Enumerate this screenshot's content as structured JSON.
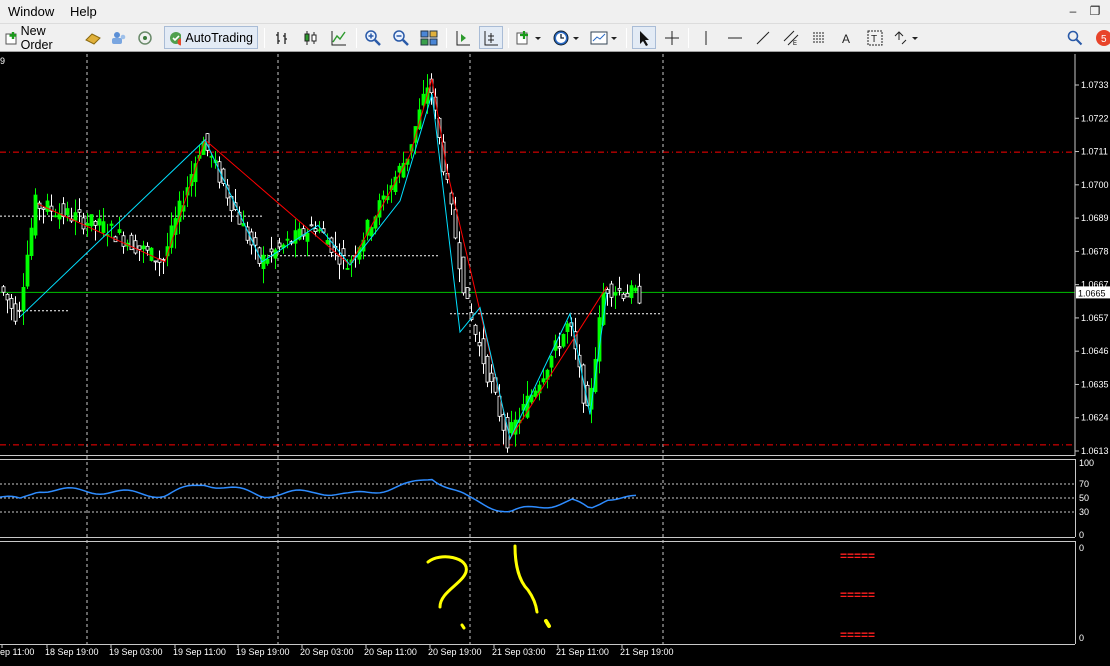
{
  "menu": {
    "window_label": "Window",
    "help_label": "Help"
  },
  "toolbar": {
    "new_order_label": "New Order",
    "autotrading_label": "AutoTrading",
    "notification_badge": "5"
  },
  "chart": {
    "corner_fragment": "9",
    "current_price": "1.0665",
    "price_ticks": [
      "1.0733",
      "1.0722",
      "1.0711",
      "1.0700",
      "1.0689",
      "1.0678",
      "1.0667",
      "1.0657",
      "1.0646",
      "1.0635",
      "1.0624",
      "1.0613"
    ],
    "oscillator_ticks": [
      "100",
      "70",
      "50",
      "30",
      "0"
    ],
    "empty_panel_ticks": [
      "0",
      "0"
    ],
    "time_labels": [
      "ep 11:00",
      "18 Sep 19:00",
      "19 Sep 03:00",
      "19 Sep 11:00",
      "19 Sep 19:00",
      "20 Sep 03:00",
      "20 Sep 11:00",
      "20 Sep 19:00",
      "21 Sep 03:00",
      "21 Sep 11:00",
      "21 Sep 19:00"
    ],
    "indicator_marks": [
      "=====",
      "=====",
      "====="
    ],
    "colors": {
      "background": "#000000",
      "bull_candle": "#00ff00",
      "bear_candle": "#ffffff",
      "zigzag_red": "#ff0000",
      "zigzag_cyan": "#00e0ff",
      "level_line": "#ff0000",
      "bid_line": "#00c000",
      "oscillator_line": "#2e8cff",
      "annotation": "#ffff00"
    }
  }
}
